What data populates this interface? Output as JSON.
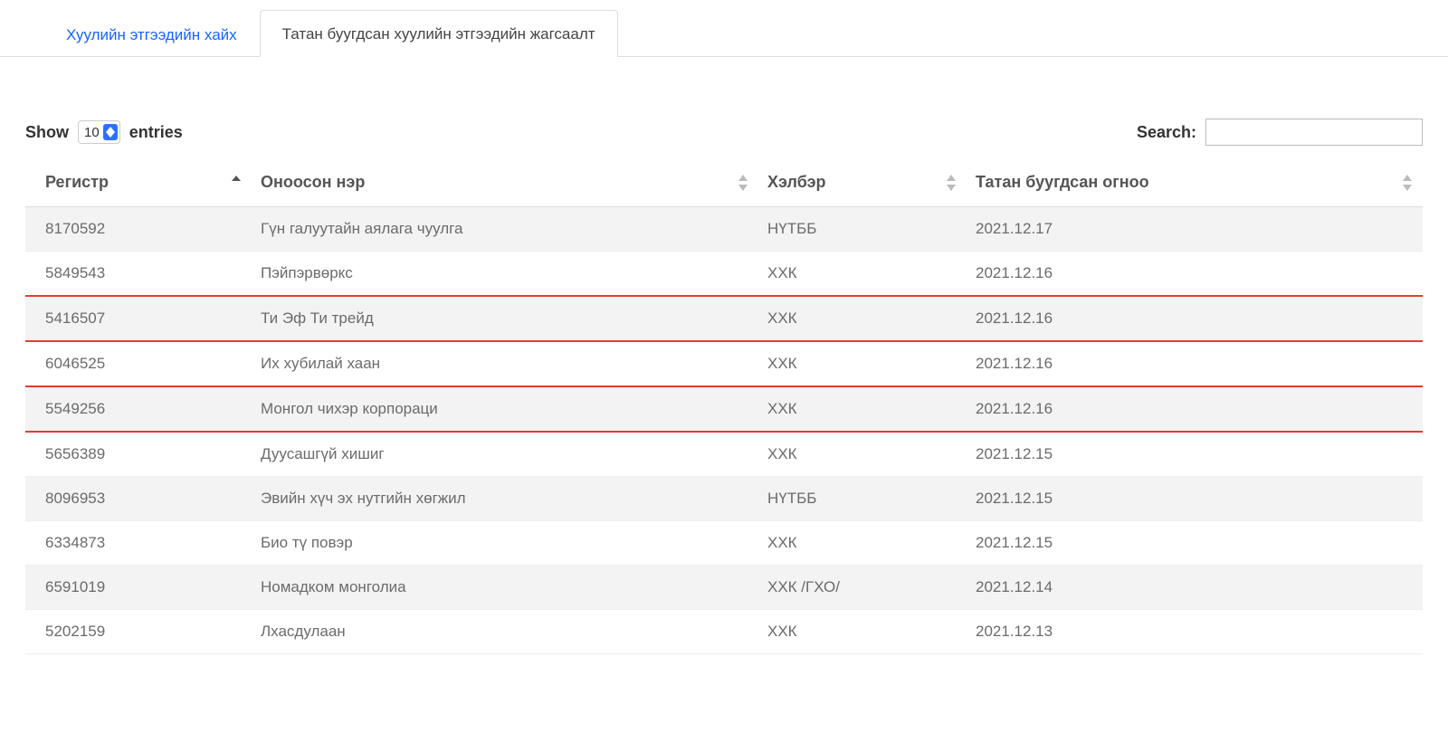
{
  "tabs": {
    "search": "Хуулийн этгээдийн хайх",
    "list": "Татан буугдсан хуулийн этгээдийн жагсаалт"
  },
  "toolbar": {
    "show": "Show",
    "entries": "entries",
    "page_size": "10",
    "search": "Search:"
  },
  "columns": {
    "register": "Регистр",
    "name": "Оноосон нэр",
    "form": "Хэлбэр",
    "date": "Татан буугдсан огноо"
  },
  "rows": [
    {
      "reg": "8170592",
      "name": "Гүн галуутайн аялага чуулга",
      "form": "НҮТББ",
      "date": "2021.12.17",
      "stripe": true,
      "hl": false
    },
    {
      "reg": "5849543",
      "name": "Пэйпэрвөркс",
      "form": "ХХК",
      "date": "2021.12.16",
      "stripe": false,
      "hl": true
    },
    {
      "reg": "5416507",
      "name": "Ти Эф Ти трейд",
      "form": "ХХК",
      "date": "2021.12.16",
      "stripe": true,
      "hl": true
    },
    {
      "reg": "6046525",
      "name": "Их хубилай хаан",
      "form": "ХХК",
      "date": "2021.12.16",
      "stripe": false,
      "hl": true
    },
    {
      "reg": "5549256",
      "name": "Монгол чихэр корпораци",
      "form": "ХХК",
      "date": "2021.12.16",
      "stripe": true,
      "hl": true
    },
    {
      "reg": "5656389",
      "name": "Дуусашгүй хишиг",
      "form": "ХХК",
      "date": "2021.12.15",
      "stripe": false,
      "hl": false
    },
    {
      "reg": "8096953",
      "name": "Эвийн хүч эх нутгийн хөгжил",
      "form": "НҮТББ",
      "date": "2021.12.15",
      "stripe": true,
      "hl": false
    },
    {
      "reg": "6334873",
      "name": "Био тү повэр",
      "form": "ХХК",
      "date": "2021.12.15",
      "stripe": false,
      "hl": false
    },
    {
      "reg": "6591019",
      "name": "Номадком монголиа",
      "form": "ХХК /ГХО/",
      "date": "2021.12.14",
      "stripe": true,
      "hl": false
    },
    {
      "reg": "5202159",
      "name": "Лхасдулаан",
      "form": "ХХК",
      "date": "2021.12.13",
      "stripe": false,
      "hl": false
    }
  ]
}
